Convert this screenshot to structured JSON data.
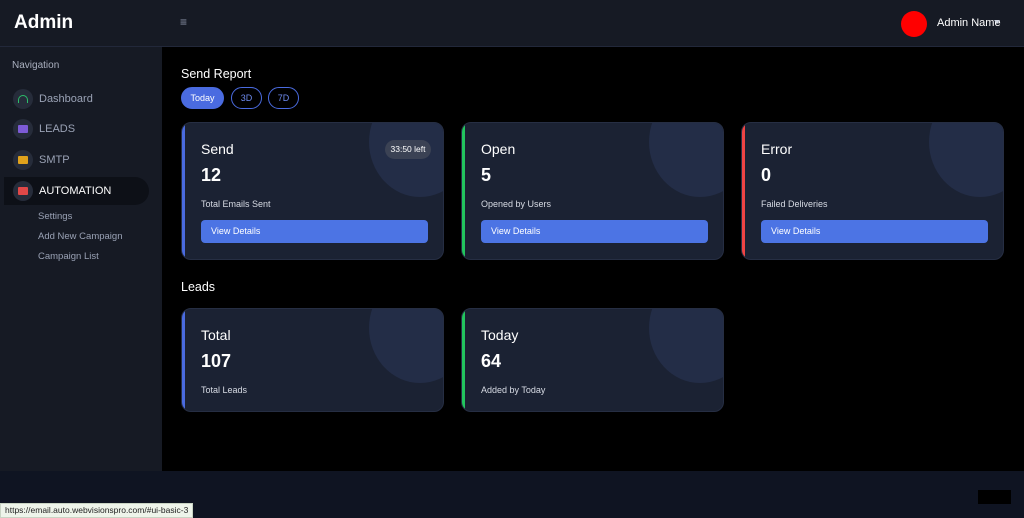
{
  "header": {
    "brand": "Admin",
    "menu_icon": "hamburger-icon",
    "user_name": "Admin Name",
    "avatar_color": "#ff0000"
  },
  "sidebar": {
    "heading": "Navigation",
    "items": [
      {
        "label": "Dashboard",
        "icon": "gauge-icon",
        "icon_color": "#2bbf6a"
      },
      {
        "label": "LEADS",
        "icon": "id-card-icon",
        "icon_color": "#7d5bd6"
      },
      {
        "label": "SMTP",
        "icon": "id-card-icon",
        "icon_color": "#e0a21c"
      },
      {
        "label": "AUTOMATION",
        "icon": "id-card-icon",
        "icon_color": "#e04848",
        "active": true
      }
    ],
    "sub_items": [
      "Settings",
      "Add New Campaign",
      "Campaign List"
    ]
  },
  "send_report": {
    "title": "Send Report",
    "filters": [
      "Today",
      "3D",
      "7D"
    ],
    "cards": [
      {
        "title": "Send",
        "value": "12",
        "subtitle": "Total Emails Sent",
        "button": "View Details",
        "badge": "33:50 left",
        "accent": "#4a6be0"
      },
      {
        "title": "Open",
        "value": "5",
        "subtitle": "Opened by Users",
        "button": "View Details",
        "accent": "#22c55e"
      },
      {
        "title": "Error",
        "value": "0",
        "subtitle": "Failed Deliveries",
        "button": "View Details",
        "accent": "#ef4444"
      }
    ]
  },
  "leads": {
    "title": "Leads",
    "cards": [
      {
        "title": "Total",
        "value": "107",
        "subtitle": "Total Leads",
        "accent": "#4a6be0"
      },
      {
        "title": "Today",
        "value": "64",
        "subtitle": "Added by Today",
        "accent": "#22c55e"
      }
    ]
  },
  "status_bar": {
    "url": "https://email.auto.webvisionspro.com/#ui-basic-3"
  }
}
